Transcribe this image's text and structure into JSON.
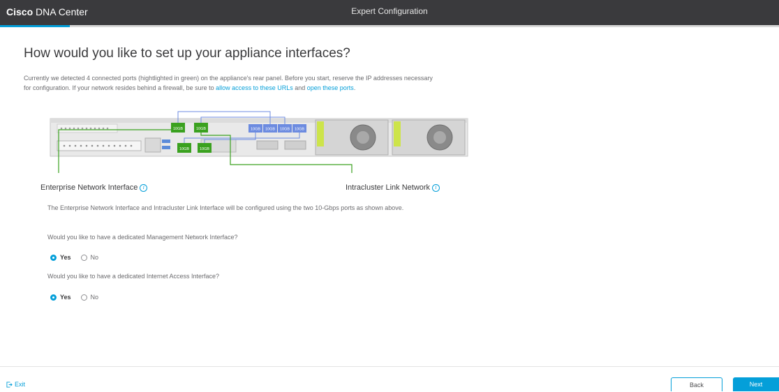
{
  "header": {
    "brand_bold": "Cisco",
    "brand_rest": " DNA Center",
    "center_title": "Expert Configuration",
    "progress": 0.09
  },
  "main": {
    "title": "How would you like to set up your appliance interfaces?",
    "intro_part1": "Currently we detected 4 connected ports (hightlighted in green) on the appliance's rear panel. Before you start, reserve the IP addresses necessary for configuration. If your network resides behind a firewall, be sure to ",
    "intro_link1": "allow access to these URLs",
    "intro_part2": " and ",
    "intro_link2": "open these ports",
    "intro_part3": ".",
    "diagram": {
      "port_label": "10GB",
      "connected_color": "#3aa11f",
      "unconnected_color": "#6c8be0"
    },
    "enterprise_label": "Enterprise Network Interface",
    "intracluster_label": "Intracluster Link Network",
    "info_icon_glyph": "i",
    "config_note": "The Enterprise Network Interface and Intracluster Link Interface will be configured using the two 10-Gbps ports as shown above.",
    "q1": {
      "question": "Would you like to have a dedicated Management Network Interface?",
      "yes": "Yes",
      "no": "No",
      "selected": "Yes"
    },
    "q2": {
      "question": "Would you like to have a dedicated Internet Access Interface?",
      "yes": "Yes",
      "no": "No",
      "selected": "Yes"
    }
  },
  "footer": {
    "exit_label": "Exit",
    "back_label": "Back",
    "next_label": "Next"
  },
  "colors": {
    "accent": "#049fd9",
    "topbar": "#3a3a3d"
  }
}
